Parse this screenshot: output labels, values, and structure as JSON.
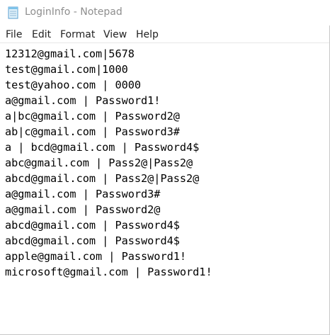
{
  "window": {
    "title": "LoginInfo - Notepad",
    "app_icon": "notepad-icon"
  },
  "menu": {
    "items": [
      "File",
      "Edit",
      "Format",
      "View",
      "Help"
    ]
  },
  "editor": {
    "lines": [
      "12312@gmail.com|5678",
      "test@gmail.com|1000",
      "test@yahoo.com | 0000",
      "a@gmail.com | Password1!",
      "a|bc@gmail.com | Password2@",
      "ab|c@gmail.com | Password3#",
      "a | bcd@gmail.com | Password4$",
      "abc@gmail.com | Pass2@|Pass2@",
      "abcd@gmail.com | Pass2@|Pass2@",
      "a@gmail.com | Password3#",
      "a@gmail.com | Password2@",
      "abcd@gmail.com | Password4$",
      "abcd@gmail.com | Password4$",
      "apple@gmail.com | Password1!",
      "microsoft@gmail.com | Password1!"
    ]
  }
}
